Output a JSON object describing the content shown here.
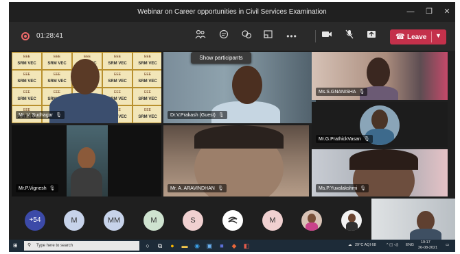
{
  "window": {
    "title": "Webinar on Career opportunities in Civil Services Examination",
    "minimize": "—",
    "restore": "❐",
    "close": "✕"
  },
  "toolbar": {
    "timer": "01:28:41",
    "leave_label": "Leave",
    "icons": [
      "participants-icon",
      "chat-icon",
      "reactions-icon",
      "share-tray-icon",
      "more-icon",
      "camera-icon",
      "mic-off-icon",
      "share-icon"
    ]
  },
  "tooltip": "Show participants",
  "tiles": [
    {
      "name": "Mr. V. Sudhagar"
    },
    {
      "name": "Dr.V.Prakash (Guest)"
    },
    {
      "name": "Ms.S.GNANISHA"
    },
    {
      "name": "Mr.G.PrathickVasan"
    },
    {
      "name": "Mr.P.Vignesh"
    },
    {
      "name": "Mr. A. ARAVINDHAN"
    },
    {
      "name": "Ms.P.Yuvalakshmi"
    }
  ],
  "logo": {
    "line1": "EEE",
    "line2": "SRM VEC"
  },
  "avatars": [
    {
      "label": "+54",
      "color": "#3c4aa8"
    },
    {
      "label": "M",
      "color": "#c7d3ea"
    },
    {
      "label": "MM",
      "color": "#c7d3ea"
    },
    {
      "label": "M",
      "color": "#cfe3d0"
    },
    {
      "label": "S",
      "color": "#f0d0d0"
    },
    {
      "label": "",
      "color": "#ffffff"
    },
    {
      "label": "M",
      "color": "#f0d0d0"
    }
  ],
  "taskbar": {
    "search_placeholder": "Type here to search",
    "weather": "29°C AQI 68",
    "lang": "ENG",
    "time": "19:17",
    "date": "26-08-2021"
  }
}
